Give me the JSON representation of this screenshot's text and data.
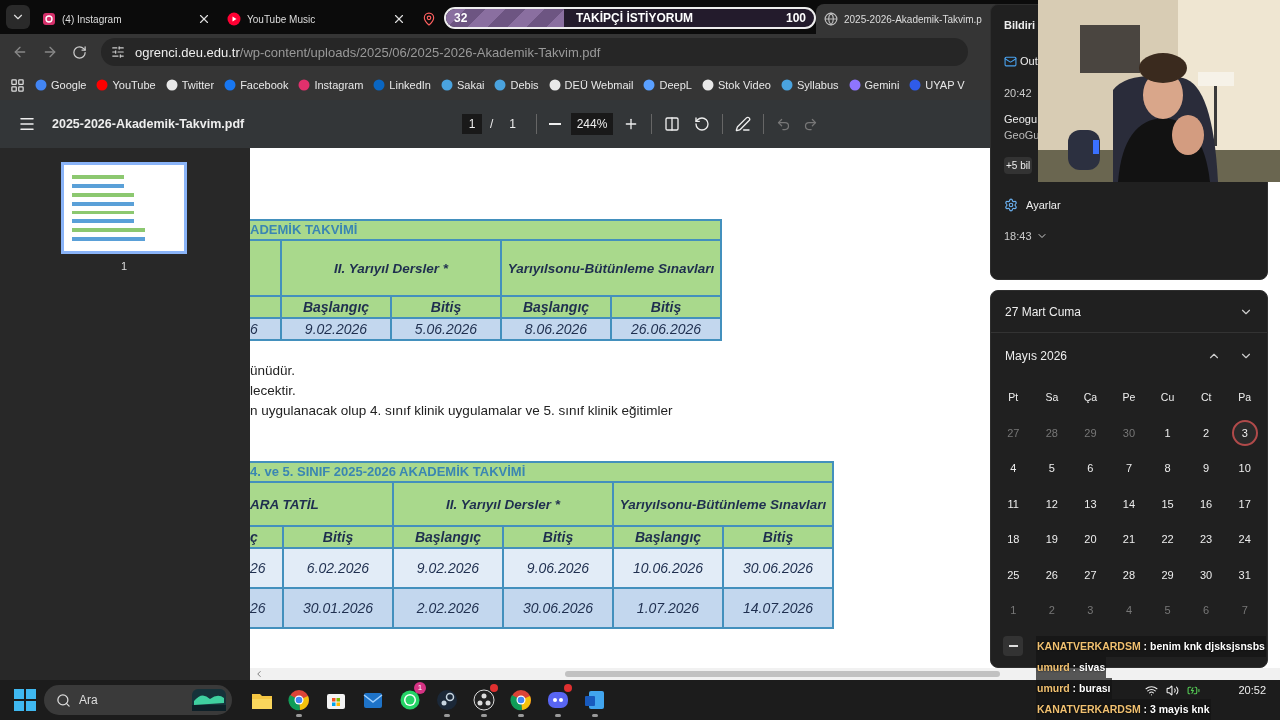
{
  "tabs": [
    {
      "title": "(4) Instagram",
      "selected": false,
      "closable": true
    },
    {
      "title": "YouTube Music",
      "selected": false,
      "closable": true
    },
    {
      "selected": false,
      "closable": false
    },
    {
      "title": "2025-2026-Akademik-Takvim.p",
      "selected": true,
      "closable": false
    }
  ],
  "goal_overlay": {
    "start": "32",
    "label": "TAKİPÇİ İSTİYORUM",
    "end": "100",
    "level": 0.32
  },
  "address": {
    "host": "ogrenci.deu.edu.tr",
    "path": "/wp-content/uploads/2025/06/2025-2026-Akademik-Takvim.pdf"
  },
  "bookmarks": [
    "Google",
    "YouTube",
    "Twitter",
    "Facebook",
    "Instagram",
    "LinkedIn",
    "Sakai",
    "Debis",
    "DEÜ Webmail",
    "DeepL",
    "Stok Video",
    "Syllabus",
    "Gemini",
    "UYAP V"
  ],
  "pdf_toolbar": {
    "filename": "2025-2026-Akademik-Takvim.pdf",
    "page": "1",
    "separator": "/",
    "pages": "1",
    "zoom": "244%"
  },
  "thumbnails": [
    {
      "label": "1",
      "selected": true
    }
  ],
  "document": {
    "tables": [
      {
        "title": "ADEMİK TAKVİMİ",
        "groups": [
          {
            "label": "II. Yarıyıl Dersler *"
          },
          {
            "label": "Yarıyılsonu-Bütünleme Sınavları"
          }
        ],
        "subheaders": [
          "Başlangıç",
          "Bitiş",
          "Başlangıç",
          "Bitiş"
        ],
        "rows": [
          {
            "shaded": true,
            "cells": [
              "6",
              "9.02.2026",
              "5.06.2026",
              "8.06.2026",
              "26.06.2026"
            ]
          }
        ]
      },
      {
        "title": "4. ve 5. SINIF 2025-2026 AKADEMİK TAKVİMİ",
        "lead_subheader": "ç",
        "groups": [
          {
            "label": "ARA TATİL"
          },
          {
            "label": "II. Yarıyıl Dersler *"
          },
          {
            "label": "Yarıyılsonu-Bütünleme Sınavları"
          }
        ],
        "subheaders": [
          "Bitiş",
          "Başlangıç",
          "Bitiş",
          "Başlangıç",
          "Bitiş"
        ],
        "rows": [
          {
            "shaded": false,
            "cells": [
              "26",
              "6.02.2026",
              "9.02.2026",
              "9.06.2026",
              "10.06.2026",
              "30.06.2026"
            ]
          },
          {
            "shaded": true,
            "cells": [
              "26",
              "30.01.2026",
              "2.02.2026",
              "30.06.2026",
              "1.07.2026",
              "14.07.2026"
            ]
          }
        ]
      }
    ],
    "lines": [
      "ünüdür.",
      "lecektir.",
      "n uygulanacak olup 4. sınıf klinik uygulamalar ve 5. sınıf klinik eğitimler"
    ]
  },
  "notifications": {
    "header": "Bildiri",
    "app": "Out",
    "time": "20:42",
    "title": "Geogu",
    "body": "GeoGu",
    "more": "+5 bil",
    "settings": "Ayarlar",
    "time2": "18:43"
  },
  "calendar": {
    "date": "27 Mart Cuma",
    "month": "Mayıs 2026",
    "weekdays": [
      "Pt",
      "Sa",
      "Ça",
      "Pe",
      "Cu",
      "Ct",
      "Pa"
    ],
    "days": [
      {
        "d": "27",
        "outside": true,
        "selected": false
      },
      {
        "d": "28",
        "outside": true,
        "selected": false
      },
      {
        "d": "29",
        "outside": true,
        "selected": false
      },
      {
        "d": "30",
        "outside": true,
        "selected": false
      },
      {
        "d": "1",
        "outside": false,
        "selected": false
      },
      {
        "d": "2",
        "outside": false,
        "selected": false
      },
      {
        "d": "3",
        "outside": false,
        "selected": true
      },
      {
        "d": "4",
        "outside": false,
        "selected": false
      },
      {
        "d": "5",
        "outside": false,
        "selected": false
      },
      {
        "d": "6",
        "outside": false,
        "selected": false
      },
      {
        "d": "7",
        "outside": false,
        "selected": false
      },
      {
        "d": "8",
        "outside": false,
        "selected": false
      },
      {
        "d": "9",
        "outside": false,
        "selected": false
      },
      {
        "d": "10",
        "outside": false,
        "selected": false
      },
      {
        "d": "11",
        "outside": false,
        "selected": false
      },
      {
        "d": "12",
        "outside": false,
        "selected": false
      },
      {
        "d": "13",
        "outside": false,
        "selected": false
      },
      {
        "d": "14",
        "outside": false,
        "selected": false
      },
      {
        "d": "15",
        "outside": false,
        "selected": false
      },
      {
        "d": "16",
        "outside": false,
        "selected": false
      },
      {
        "d": "17",
        "outside": false,
        "selected": false
      },
      {
        "d": "18",
        "outside": false,
        "selected": false
      },
      {
        "d": "19",
        "outside": false,
        "selected": false
      },
      {
        "d": "20",
        "outside": false,
        "selected": false
      },
      {
        "d": "21",
        "outside": false,
        "selected": false
      },
      {
        "d": "22",
        "outside": false,
        "selected": false
      },
      {
        "d": "23",
        "outside": false,
        "selected": false
      },
      {
        "d": "24",
        "outside": false,
        "selected": false
      },
      {
        "d": "25",
        "outside": false,
        "selected": false
      },
      {
        "d": "26",
        "outside": false,
        "selected": false
      },
      {
        "d": "27",
        "outside": false,
        "selected": false
      },
      {
        "d": "28",
        "outside": false,
        "selected": false
      },
      {
        "d": "29",
        "outside": false,
        "selected": false
      },
      {
        "d": "30",
        "outside": false,
        "selected": false
      },
      {
        "d": "31",
        "outside": false,
        "selected": false
      },
      {
        "d": "1",
        "outside": true,
        "selected": false
      },
      {
        "d": "2",
        "outside": true,
        "selected": false
      },
      {
        "d": "3",
        "outside": true,
        "selected": false
      },
      {
        "d": "4",
        "outside": true,
        "selected": false
      },
      {
        "d": "5",
        "outside": true,
        "selected": false
      },
      {
        "d": "6",
        "outside": true,
        "selected": false
      },
      {
        "d": "7",
        "outside": true,
        "selected": false
      }
    ]
  },
  "chat": [
    {
      "user": "KANATVERKARDSM",
      "message": ": benim knk djsksjsnsbs"
    },
    {
      "user": "umurd",
      "message": ": sivas"
    },
    {
      "user": "umurd",
      "message": ": burası"
    },
    {
      "user": "KANATVERKARDSM",
      "message": ": 3 mayis knk"
    }
  ],
  "taskbar": {
    "search": "Ara",
    "clock": "20:52",
    "apps": [
      {
        "kind": "folder",
        "running": false,
        "alert": false
      },
      {
        "kind": "browser",
        "running": true,
        "alert": false
      },
      {
        "kind": "store",
        "running": false,
        "alert": false
      },
      {
        "kind": "mail",
        "running": false,
        "alert": false
      },
      {
        "kind": "chat",
        "running": false,
        "alert": false,
        "badge": "1"
      },
      {
        "kind": "steam",
        "running": true,
        "alert": false
      },
      {
        "kind": "record",
        "running": true,
        "alert": true
      },
      {
        "kind": "browser",
        "running": true,
        "alert": false
      },
      {
        "kind": "discord",
        "running": true,
        "alert": true
      },
      {
        "kind": "word",
        "running": true,
        "alert": false
      }
    ]
  }
}
